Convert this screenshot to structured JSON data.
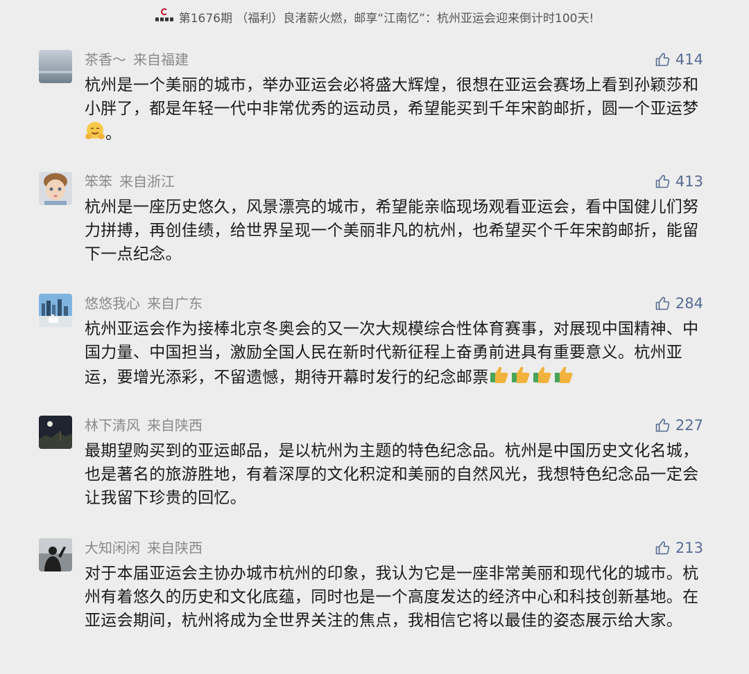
{
  "article_title": "第1676期 （福利）良渚薪火燃，邮享“江南忆”：杭州亚运会迎来倒计时100天!",
  "icons": {
    "logo": "publisher-logo",
    "like": "thumbs-up-outline-icon"
  },
  "comments": [
    {
      "name": "茶香～",
      "location": "来自福建",
      "likes": "414",
      "text": "杭州是一个美丽的城市，举办亚运会必将盛大辉煌，很想在亚运会赛场上看到孙颖莎和小胖了，都是年轻一代中非常优秀的运动员，希望能买到千年宋韵邮折，圆一个亚运梦",
      "trailing": "。",
      "emoji": "smiling-face-with-hands-icon"
    },
    {
      "name": "笨笨",
      "location": "来自浙江",
      "likes": "413",
      "text": "杭州是一座历史悠久，风景漂亮的城市，希望能亲临现场观看亚运会，看中国健儿们努力拼搏，再创佳绩，给世界呈现一个美丽非凡的杭州，也希望买个千年宋韵邮折，能留下一点纪念。"
    },
    {
      "name": "悠悠我心",
      "location": "来自广东",
      "likes": "284",
      "text": "杭州亚运会作为接棒北京冬奥会的又一次大规模综合性体育赛事，对展现中国精神、中国力量、中国担当，激励全国人民在新时代新征程上奋勇前进具有重要意义。杭州亚运，要增光添彩，不留遗憾，期待开幕时发行的纪念邮票",
      "emoji": "thumbs-up-emoji-x4"
    },
    {
      "name": "林下清风",
      "location": "来自陕西",
      "likes": "227",
      "text": "最期望购买到的亚运邮品，是以杭州为主题的特色纪念品。杭州是中国历史文化名城，也是著名的旅游胜地，有着深厚的文化积淀和美丽的自然风光，我想特色纪念品一定会让我留下珍贵的回忆。"
    },
    {
      "name": "大知闲闲",
      "location": "来自陕西",
      "likes": "213",
      "text": "对于本届亚运会主协办城市杭州的印象，我认为它是一座非常美丽和现代化的城市。杭州有着悠久的历史和文化底蕴，同时也是一个高度发达的经济中心和科技创新基地。在亚运会期间，杭州将成为全世界关注的焦点，我相信它将以最佳的姿态展示给大家。"
    }
  ]
}
